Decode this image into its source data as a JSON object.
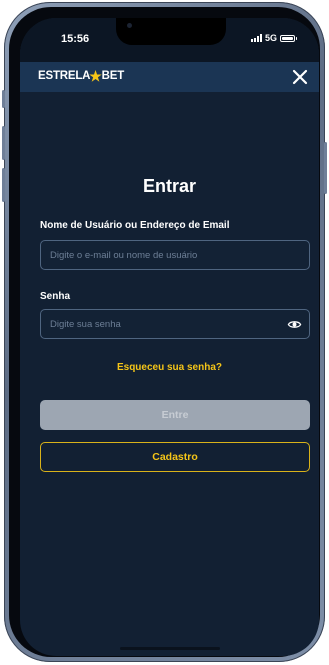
{
  "status_bar": {
    "time": "15:56",
    "network": "5G"
  },
  "app_bar": {
    "logo_part1": "ESTRELA",
    "logo_part2": "BET",
    "close_icon": "close-icon"
  },
  "login": {
    "title": "Entrar",
    "username_label": "Nome de Usuário ou Endereço de Email",
    "username_placeholder": "Digite o e-mail ou nome de usuário",
    "password_label": "Senha",
    "password_placeholder": "Digite sua senha",
    "forgot_link": "Esqueceu sua senha?",
    "login_button": "Entre",
    "register_button": "Cadastro"
  },
  "colors": {
    "background": "#122033",
    "header": "#1b3554",
    "accent": "#f5c518",
    "disabled_button": "#9da6b2"
  }
}
